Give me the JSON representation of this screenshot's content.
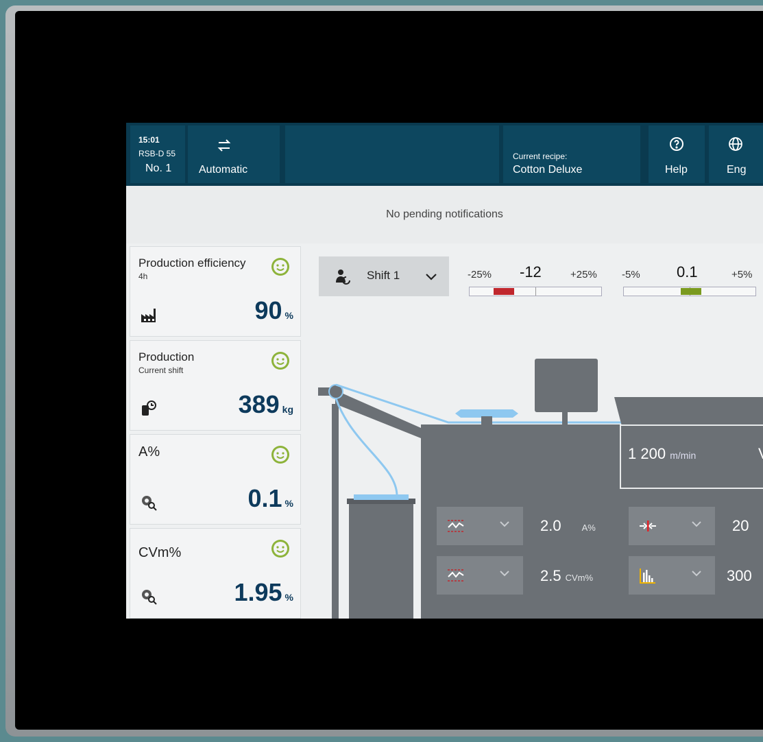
{
  "header": {
    "time": "15:01",
    "machine_model": "RSB-D 55",
    "machine_no": "No. 1",
    "mode_label": "Automatic",
    "recipe_caption": "Current recipe:",
    "recipe_name": "Cotton Deluxe",
    "help_label": "Help",
    "lang_label": "Eng"
  },
  "notifications": {
    "text": "No pending notifications"
  },
  "kpis": [
    {
      "title": "Production efficiency",
      "sub": "4h",
      "value": "90",
      "unit": "%",
      "icon": "factory-icon",
      "status": "happy"
    },
    {
      "title": "Production",
      "sub": "Current shift",
      "value": "389",
      "unit": "kg",
      "icon": "bobbin-clock-icon",
      "status": "happy"
    },
    {
      "title": "A%",
      "sub": "",
      "value": "0.1",
      "unit": "%",
      "icon": "sliver-search-icon",
      "status": "happy"
    },
    {
      "title": "CVm%",
      "sub": "",
      "value": "1.95",
      "unit": "%",
      "icon": "sliver-search-icon",
      "status": "happy"
    }
  ],
  "shift": {
    "label": "Shift 1"
  },
  "tolerances": [
    {
      "low": "-25%",
      "high": "+25%",
      "value": "-12",
      "color": "#c0272d",
      "fraction": -0.48
    },
    {
      "low": "-5%",
      "high": "+5%",
      "value": "0.1",
      "color": "#7a9a1f",
      "fraction": 0.02
    }
  ],
  "machine": {
    "speed_value": "1 200",
    "speed_unit": "m/min",
    "speed_extra": "V"
  },
  "controls": [
    {
      "icon": "deviation-chart-icon",
      "value": "2.0",
      "unit": "A%"
    },
    {
      "icon": "deviation-chart-icon",
      "value": "2.5",
      "unit": "CVm%"
    },
    {
      "icon": "draft-arrows-icon",
      "value": "20",
      "unit": ""
    },
    {
      "icon": "histogram-icon",
      "value": "300",
      "unit": ""
    }
  ],
  "colors": {
    "header_bg": "#0a3a4f",
    "value_text": "#0d3a5c",
    "smiley": "#8db33a",
    "machine_gray": "#6b7075",
    "yarn_blue": "#8ec8f0"
  }
}
